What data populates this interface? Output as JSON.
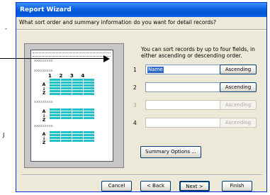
{
  "window": {
    "title": "Report Wizard"
  },
  "question": "What sort order and summary information do you want for detail records?",
  "description": "You can sort records by up to four fields, in either ascending or descending order.",
  "sort_rows": [
    {
      "number": "1",
      "field": "Name",
      "order": "Ascending",
      "enabled": true
    },
    {
      "number": "2",
      "field": "",
      "order": "Ascending",
      "enabled": true
    },
    {
      "number": "3",
      "field": "",
      "order": "Ascending",
      "enabled": false
    },
    {
      "number": "4",
      "field": "",
      "order": "Ascending",
      "enabled": false
    }
  ],
  "illustration": {
    "column_numbers": [
      "1",
      "2",
      "3",
      "4"
    ],
    "placeholder": "xxxxxxxxx",
    "sort_glyph_top": "A",
    "sort_glyph_bottom": "Z"
  },
  "buttons": {
    "summary": "Summary Options ...",
    "cancel": "Cancel",
    "back": "< Back",
    "next": "Next >",
    "finish": "Finish"
  },
  "colors": {
    "title_bar": "#0a5fe0",
    "dialog_bg": "#ece9d8",
    "illustration_cells": "#20c0c8",
    "selection": "#316ac5"
  },
  "icons": {
    "dropdown": "chevron-down-icon",
    "sort": "sort-az-icon",
    "callout_arrow": "arrow-right-icon"
  }
}
